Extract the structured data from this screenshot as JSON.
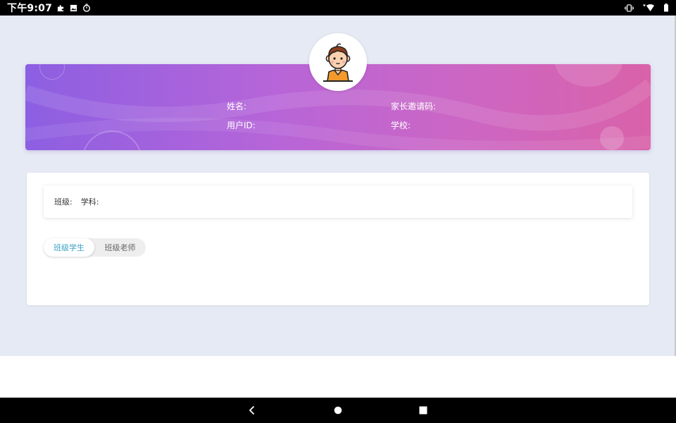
{
  "status_bar": {
    "time": "下午9:07",
    "left_icons": [
      "puzzle-icon",
      "image-icon",
      "timer-icon"
    ],
    "right_icons": [
      "vibrate-icon",
      "wifi-icon",
      "battery-icon"
    ]
  },
  "profile": {
    "name_label": "姓名:",
    "parent_invite_label": "家长邀请码:",
    "user_id_label": "用户ID:",
    "school_label": "学校:"
  },
  "class_info": {
    "class_label": "班级:",
    "subject_label": "学科:"
  },
  "tabs": {
    "active": "班级学生",
    "inactive": "班级老师"
  },
  "colors": {
    "gradient_start": "#8c5fe2",
    "gradient_end": "#d962a9",
    "tab_active_text": "#3aa0c8",
    "page_bg": "#e6eaf4"
  },
  "nav_bar": {
    "buttons": [
      "back-icon",
      "home-icon",
      "recents-icon"
    ]
  }
}
